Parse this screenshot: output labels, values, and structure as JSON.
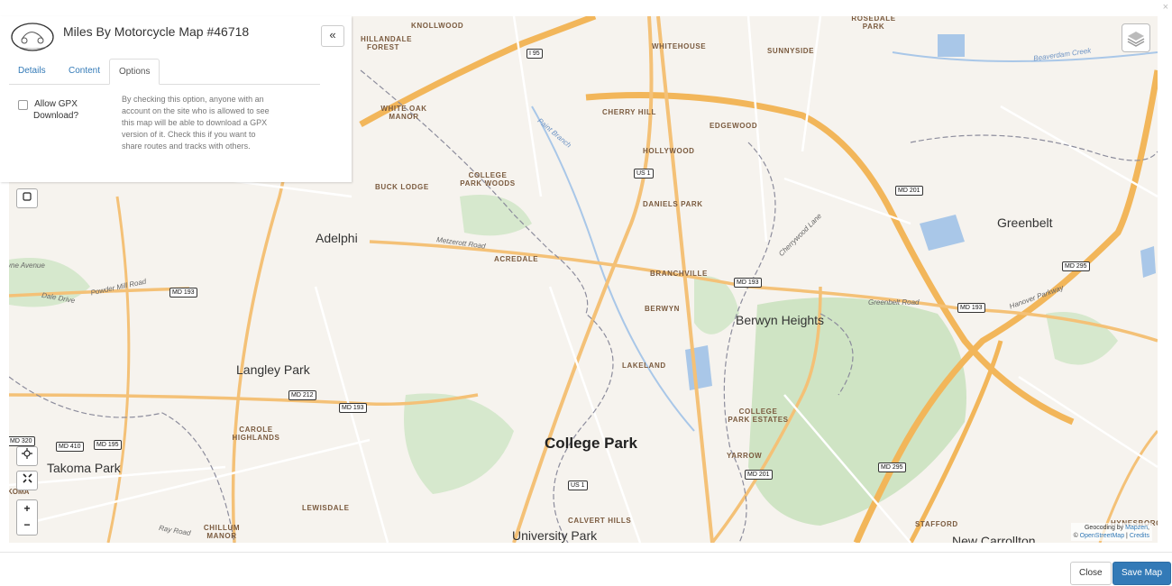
{
  "dialog": {
    "title": "Miles By Motorcycle Map #46718",
    "collapse_glyph": "«",
    "close_glyph": "×"
  },
  "tabs": [
    {
      "label": "Details",
      "active": false
    },
    {
      "label": "Content",
      "active": false
    },
    {
      "label": "Options",
      "active": true
    }
  ],
  "options": {
    "allow_gpx_label": "Allow GPX Download?",
    "allow_gpx_checked": false,
    "allow_gpx_help": "By checking this option, anyone with an account on the site who is allowed to see this map will be able to download a GPX version of it. Check this if you want to share routes and tracks with others."
  },
  "map_controls": {
    "select_icon": "square-select-icon",
    "locate_icon": "crosshair-icon",
    "fit_icon": "fit-bounds-icon",
    "zoom_in": "+",
    "zoom_out": "−",
    "layers_icon": "layers-icon"
  },
  "map_labels": {
    "places": [
      "Adelphi",
      "Langley Park",
      "Takoma Park",
      "College Park",
      "Berwyn Heights",
      "Greenbelt",
      "University Park",
      "New Carrollton"
    ],
    "neighborhoods": [
      "HILLANDALE FOREST",
      "KNOLLWOOD",
      "WHITEHOUSE",
      "SUNNYSIDE",
      "ROSEDALE PARK",
      "WHITE OAK MANOR",
      "CHERRY HILL",
      "EDGEWOOD",
      "HOLLYWOOD",
      "COLLEGE PARK WOODS",
      "BUCK LODGE",
      "DANIELS PARK",
      "ACREDALE",
      "BRANCHVILLE",
      "BERWYN",
      "LAKELAND",
      "COLLEGE PARK ESTATES",
      "CAROLE HIGHLANDS",
      "YARROW",
      "LEWISDALE",
      "CALVERT HILLS",
      "CHILLUM MANOR",
      "STAFFORD",
      "HYNESBORO"
    ],
    "shields": [
      "I 95",
      "US 1",
      "US 1",
      "MD 201",
      "MD 201",
      "MD 295",
      "MD 295",
      "MD 193",
      "MD 193",
      "MD 193",
      "MD 193",
      "MD 212",
      "MD 410",
      "MD 195",
      "MD 320"
    ],
    "streets": [
      "Beaverdam Creek",
      "Powder Mill Road",
      "Metzerott Road",
      "Greenbelt Road",
      "Hanover Parkway",
      "Dale Drive",
      "Ray Road",
      "Cherrywood Lane",
      "Paint Branch"
    ],
    "partial": [
      "yne Avenue",
      "KOMA"
    ]
  },
  "attribution": {
    "line1_prefix": "Geocoding by ",
    "line1_link": "Mapzen",
    "line2_prefix": "© ",
    "line2_link1": "OpenStreetMap",
    "line2_sep": " | ",
    "line2_link2": "Credits"
  },
  "footer": {
    "close_label": "Close",
    "save_label": "Save Map"
  },
  "colors": {
    "map_bg": "#f6f3ee",
    "park": "#cfe4c4",
    "water": "#a9c7e8",
    "highway": "#f2b65a",
    "primary_button": "#337ab7",
    "link": "#337ab7"
  }
}
